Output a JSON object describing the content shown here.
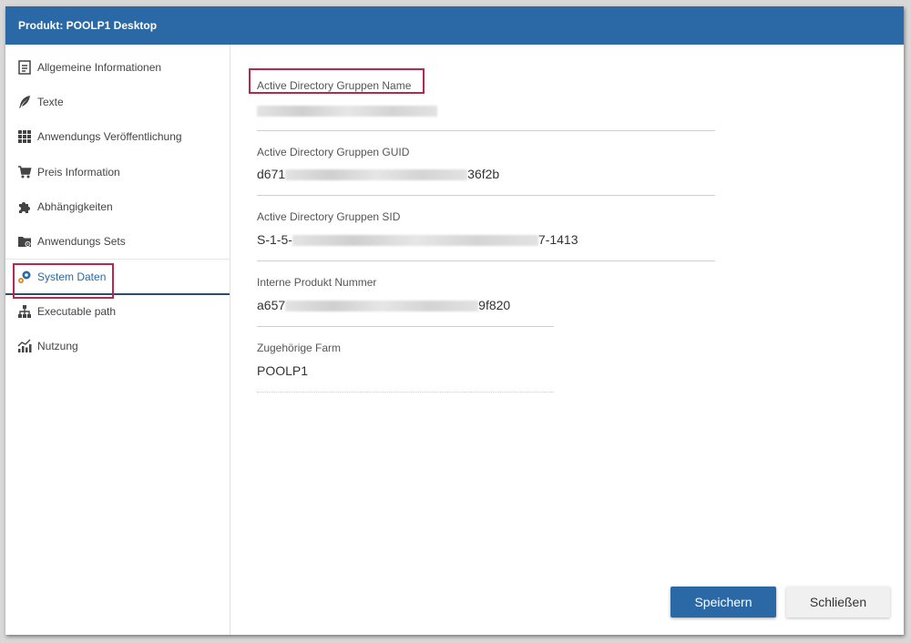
{
  "dialog": {
    "title": "Produkt: POOLP1 Desktop"
  },
  "sidebar": {
    "items": [
      {
        "label": "Allgemeine Informationen",
        "icon": "document-icon"
      },
      {
        "label": "Texte",
        "icon": "feather-icon"
      },
      {
        "label": "Anwendungs Veröffentlichung",
        "icon": "grid-icon"
      },
      {
        "label": "Preis Information",
        "icon": "cart-icon"
      },
      {
        "label": "Abhängigkeiten",
        "icon": "puzzle-icon"
      },
      {
        "label": "Anwendungs Sets",
        "icon": "folder-gear-icon"
      },
      {
        "label": "System Daten",
        "icon": "gears-icon",
        "active": true
      },
      {
        "label": "Executable path",
        "icon": "hierarchy-icon"
      },
      {
        "label": "Nutzung",
        "icon": "chart-icon"
      }
    ]
  },
  "fields": {
    "ad_group_name": {
      "label": "Active Directory Gruppen Name",
      "value": ""
    },
    "ad_group_guid": {
      "label": "Active Directory Gruppen GUID",
      "value_start": "d671",
      "value_end": "36f2b"
    },
    "ad_group_sid": {
      "label": "Active Directory Gruppen SID",
      "value_start": "S-1-5-",
      "value_end": "7-1413"
    },
    "internal_number": {
      "label": "Interne Produkt Nummer",
      "value_start": "a657",
      "value_end": "9f820"
    },
    "farm": {
      "label": "Zugehörige Farm",
      "value": "POOLP1"
    }
  },
  "buttons": {
    "save": "Speichern",
    "close": "Schließen"
  },
  "colors": {
    "primary": "#2a69a6",
    "highlight": "#b5294e"
  }
}
